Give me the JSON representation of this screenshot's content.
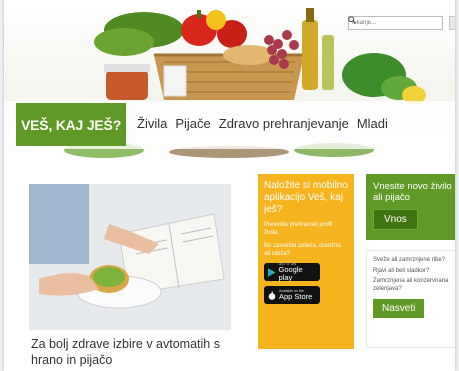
{
  "search": {
    "placeholder": "Iskanje..."
  },
  "logo": {
    "text": "VEŠ, KAJ JEŠ?"
  },
  "menu": {
    "items": [
      "Živila",
      "Pijače",
      "Zdravo prehranjevanje",
      "Mladi"
    ]
  },
  "article": {
    "title": "Za bolj zdrave izbire v avtomatih s hrano in pijačo"
  },
  "promo": {
    "title": "Naložite si mobilno aplikacijo Veš, kaj ješ?",
    "line1": "Preverite prehranski profil živila.",
    "line2": "Bo zasvetila zelena, oranžna ali rdeča?",
    "google_small": "GET IT ON",
    "google_big": "Google play",
    "apple_small": "Available on the",
    "apple_big": "App Store"
  },
  "entry": {
    "title": "Vnesite novo živilo ali pijačo",
    "button": "Vnos"
  },
  "tips": {
    "links": [
      "Sveže ali zamrznjene ribe?",
      "Rjavi ali beli sladkor?",
      "Zamrznjena ali konzervirana zelenjava?"
    ],
    "button": "Nasveti"
  },
  "colors": {
    "brand_green": "#5e9a25",
    "promo_yellow": "#f5b31d",
    "dark_green": "#3f7412"
  }
}
